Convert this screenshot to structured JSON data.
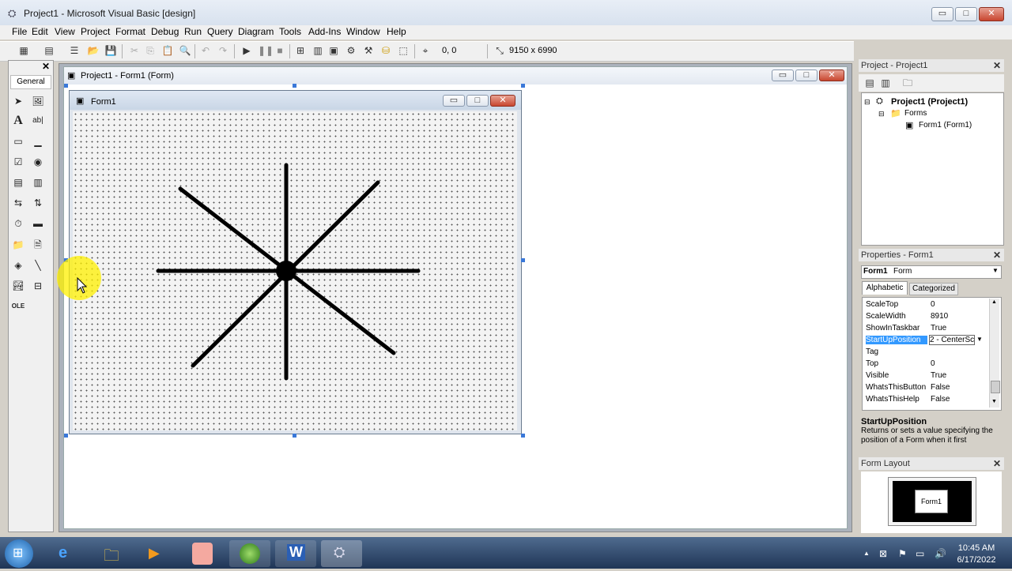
{
  "window": {
    "title": "Project1 - Microsoft Visual Basic [design]",
    "controls": {
      "minimize": "▭",
      "maximize": "□",
      "close": "✕"
    }
  },
  "menu": [
    "File",
    "Edit",
    "View",
    "Project",
    "Format",
    "Debug",
    "Run",
    "Query",
    "Diagram",
    "Tools",
    "Add-Ins",
    "Window",
    "Help"
  ],
  "toolbar": {
    "position_readout": "0, 0",
    "size_readout": "9150 x 6990"
  },
  "toolbox": {
    "title": "General"
  },
  "designer": {
    "title": "Project1 - Form1 (Form)"
  },
  "form": {
    "caption": "Form1"
  },
  "project": {
    "title": "Project - Project1",
    "root": "Project1 (Project1)",
    "folder": "Forms",
    "item": "Form1 (Form1)"
  },
  "properties": {
    "title": "Properties - Form1",
    "object_name": "Form1",
    "object_type": "Form",
    "tabs": [
      "Alphabetic",
      "Categorized"
    ],
    "rows": [
      {
        "name": "ScaleTop",
        "value": "0"
      },
      {
        "name": "ScaleWidth",
        "value": "8910"
      },
      {
        "name": "ShowInTaskbar",
        "value": "True"
      },
      {
        "name": "StartUpPosition",
        "value": "2 - CenterSc"
      },
      {
        "name": "Tag",
        "value": ""
      },
      {
        "name": "Top",
        "value": "0"
      },
      {
        "name": "Visible",
        "value": "True"
      },
      {
        "name": "WhatsThisButton",
        "value": "False"
      },
      {
        "name": "WhatsThisHelp",
        "value": "False"
      }
    ],
    "description_title": "StartUpPosition",
    "description_text": "Returns or sets a value specifying the position of a Form when it first"
  },
  "form_layout": {
    "title": "Form Layout",
    "preview_label": "Form1"
  },
  "taskbar": {
    "time": "10:45 AM",
    "date": "6/17/2022"
  },
  "colors": {
    "selection": "#3399ff",
    "taskbar": "#2c4468",
    "designer_bg": "#ffffff"
  }
}
